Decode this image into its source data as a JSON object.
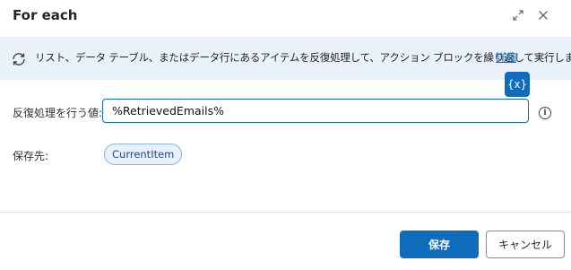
{
  "dialog": {
    "title": "For each"
  },
  "banner": {
    "text": "リスト、データ テーブル、またはデータ行にあるアイテムを反復処理して、アクション ブロックを繰り返して実行します",
    "link": "詳細"
  },
  "variable_button": {
    "label": "{x}"
  },
  "form": {
    "iterate_label": "反復処理を行う値:",
    "iterate_value": "%RetrievedEmails%",
    "save_label": "保存先:",
    "save_variable": "CurrentItem"
  },
  "footer": {
    "save_button": "保存",
    "cancel_button": "キャンセル"
  },
  "icons": {
    "expand": "expand-icon",
    "close": "close-icon",
    "loop": "loop-icon",
    "info": "info-icon"
  },
  "colors": {
    "accent": "#0f6cbd",
    "banner_bg": "#eaf1fb",
    "chip_bg": "#e8f0fb"
  }
}
